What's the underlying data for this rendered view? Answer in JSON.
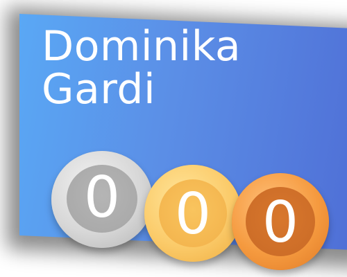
{
  "profile": {
    "first_name": "Dominika",
    "last_name": "Gardi"
  },
  "medals": {
    "silver": {
      "count": "0",
      "color": "#bfbfbf"
    },
    "gold": {
      "count": "0",
      "color": "#f3b54a"
    },
    "bronze": {
      "count": "0",
      "color": "#e07a26"
    }
  },
  "colors": {
    "card_gradient_start": "#5aa8f5",
    "card_gradient_end": "#4f6fd6",
    "text": "#ffffff"
  }
}
